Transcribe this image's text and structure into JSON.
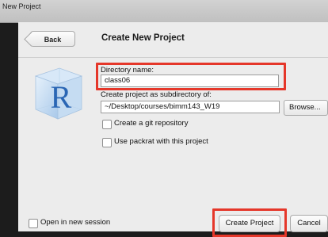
{
  "window": {
    "title": "New Project"
  },
  "header": {
    "back_label": "Back",
    "title": "Create New Project"
  },
  "logo": {
    "letter": "R"
  },
  "directory": {
    "label": "Directory name:",
    "value": "class06"
  },
  "parent_dir": {
    "label": "Create project as subdirectory of:",
    "value": "~/Desktop/courses/bimm143_W19"
  },
  "browse": {
    "label": "Browse..."
  },
  "options": {
    "git_label": "Create a git repository",
    "packrat_label": "Use packrat with this project"
  },
  "footer": {
    "new_session_label": "Open in new session",
    "create_label": "Create Project",
    "cancel_label": "Cancel"
  },
  "colors": {
    "highlight": "#e5372a",
    "r_blue": "#2a66b4"
  }
}
